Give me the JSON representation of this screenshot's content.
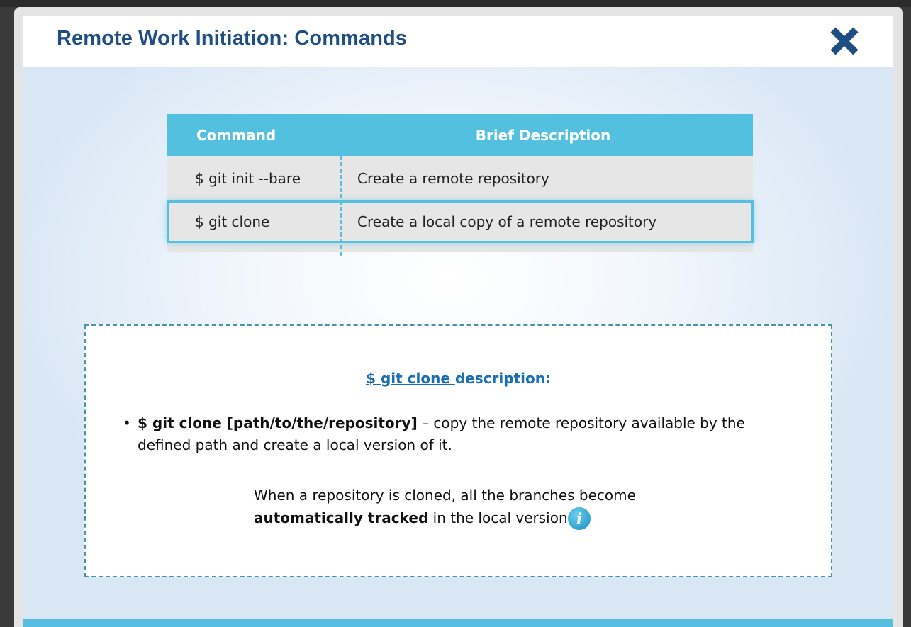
{
  "header": {
    "title": "Remote Work Initiation: Commands",
    "close_icon": "close-x-icon"
  },
  "table": {
    "columns": [
      "Command",
      "Brief Description"
    ],
    "rows": [
      {
        "command": "$ git init --bare",
        "description": "Create a remote repository",
        "selected": false
      },
      {
        "command": "$ git clone",
        "description": "Create a local copy of a remote repository",
        "selected": true
      }
    ]
  },
  "description_panel": {
    "heading_link": "$ git clone ",
    "heading_rest": "description:",
    "bullet_command": "$ git clone [path/to/the/repository]",
    "bullet_text": " – copy the remote repository available by the defined path and create a local version of it.",
    "note_line1": "When a repository is cloned, all the branches become",
    "note_bold": "automatically tracked",
    "note_rest": " in the local version",
    "info_icon": "info-icon"
  },
  "colors": {
    "title": "#1f4e85",
    "table_header": "#52c0de",
    "row_bg": "#e6e6e6",
    "link": "#1a6fb3",
    "dashed_border": "#4a94a9",
    "footer_bar": "#55bde0"
  }
}
